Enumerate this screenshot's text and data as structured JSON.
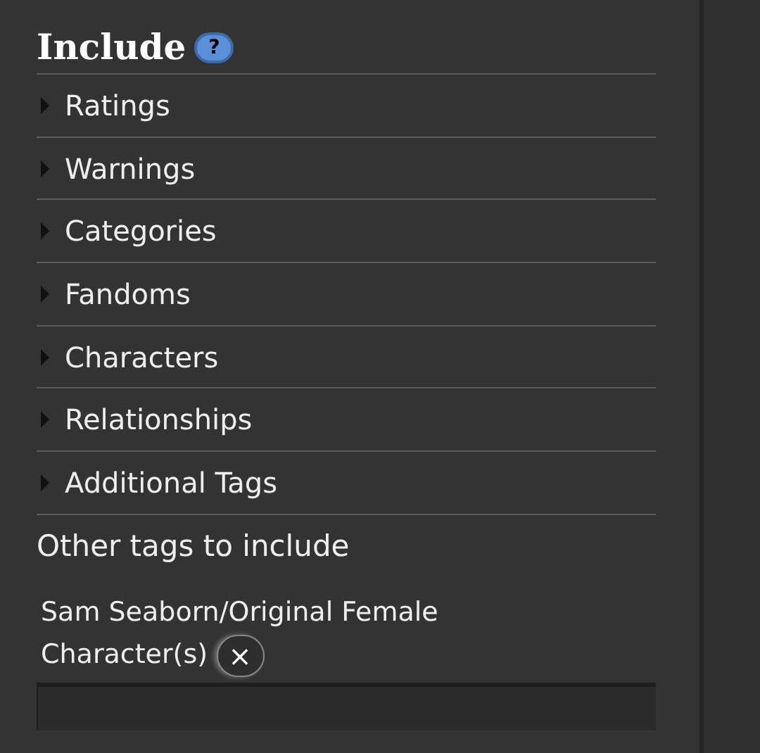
{
  "heading": {
    "title": "Include",
    "help": "?"
  },
  "filters": [
    {
      "label": "Ratings",
      "expanded": false
    },
    {
      "label": "Warnings",
      "expanded": false
    },
    {
      "label": "Categories",
      "expanded": false
    },
    {
      "label": "Fandoms",
      "expanded": false
    },
    {
      "label": "Characters",
      "expanded": false
    },
    {
      "label": "Relationships",
      "expanded": false
    },
    {
      "label": "Additional Tags",
      "expanded": false
    }
  ],
  "other_tags": {
    "label": "Other tags to include",
    "tags": [
      {
        "text": "Sam Seaborn/Original Female Character(s)",
        "remove": "×"
      }
    ]
  }
}
